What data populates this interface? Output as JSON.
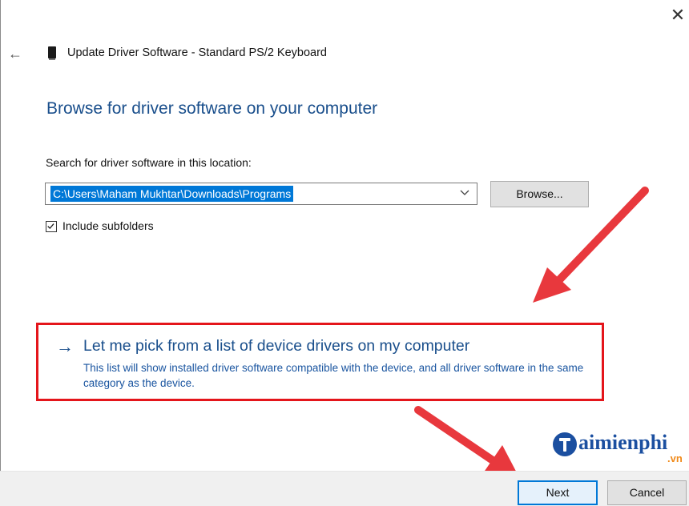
{
  "window": {
    "close_glyph": "✕",
    "back_glyph": "←",
    "title": "Update Driver Software - Standard PS/2 Keyboard"
  },
  "main": {
    "heading": "Browse for driver software on your computer",
    "search_label": "Search for driver software in this location:",
    "path_value": "C:\\Users\\Maham Mukhtar\\Downloads\\Programs",
    "browse_label": "Browse...",
    "include_subfolders_label": "Include subfolders",
    "include_subfolders_checked": true
  },
  "option": {
    "arrow_glyph": "→",
    "title": "Let me pick from a list of device drivers on my computer",
    "description": "This list will show installed driver software compatible with the device, and all driver software in the same category as the device."
  },
  "footer": {
    "next_label": "Next",
    "cancel_label": "Cancel"
  },
  "watermark": {
    "text": "aimienphi",
    "suffix": ".vn"
  },
  "colors": {
    "heading_blue": "#1a4f8c",
    "highlight_red": "#e4151b",
    "selection_blue": "#0078d7",
    "annotation_arrow": "#e8383d"
  },
  "icons": {
    "back": "back-arrow-icon",
    "device": "keyboard-device-icon",
    "close": "close-icon",
    "dropdown": "chevron-down-icon",
    "checkbox": "checkmark-icon",
    "option_arrow": "right-arrow-icon"
  }
}
